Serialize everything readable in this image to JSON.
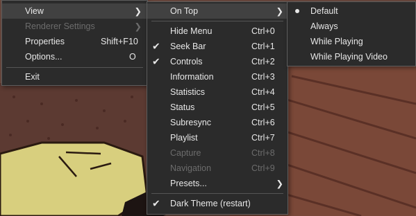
{
  "colors": {
    "menu_bg": "#2b2b2b",
    "menu_border": "#5e5e5e",
    "highlight": "#414141",
    "text": "#e8e8e8",
    "disabled_text": "#6c6c6c",
    "bg_wall": "#6e4b40",
    "bg_floor": "#7a4838",
    "cushion": "#d8cf7e"
  },
  "menu_main": {
    "view": "View",
    "renderer_settings": "Renderer Settings",
    "properties": "Properties",
    "properties_shortcut": "Shift+F10",
    "options": "Options...",
    "options_shortcut": "O",
    "exit": "Exit"
  },
  "menu_view": {
    "on_top": "On Top",
    "hide_menu": "Hide Menu",
    "hide_menu_shortcut": "Ctrl+0",
    "seek_bar": "Seek Bar",
    "seek_bar_shortcut": "Ctrl+1",
    "controls": "Controls",
    "controls_shortcut": "Ctrl+2",
    "information": "Information",
    "information_shortcut": "Ctrl+3",
    "statistics": "Statistics",
    "statistics_shortcut": "Ctrl+4",
    "status": "Status",
    "status_shortcut": "Ctrl+5",
    "subresync": "Subresync",
    "subresync_shortcut": "Ctrl+6",
    "playlist": "Playlist",
    "playlist_shortcut": "Ctrl+7",
    "capture": "Capture",
    "capture_shortcut": "Ctrl+8",
    "navigation": "Navigation",
    "navigation_shortcut": "Ctrl+9",
    "presets": "Presets...",
    "dark_theme": "Dark Theme (restart)"
  },
  "menu_ontop": {
    "default": "Default",
    "always": "Always",
    "while_playing": "While Playing",
    "while_playing_video": "While Playing Video"
  },
  "glyphs": {
    "check": "✔",
    "arrow": "❯"
  }
}
